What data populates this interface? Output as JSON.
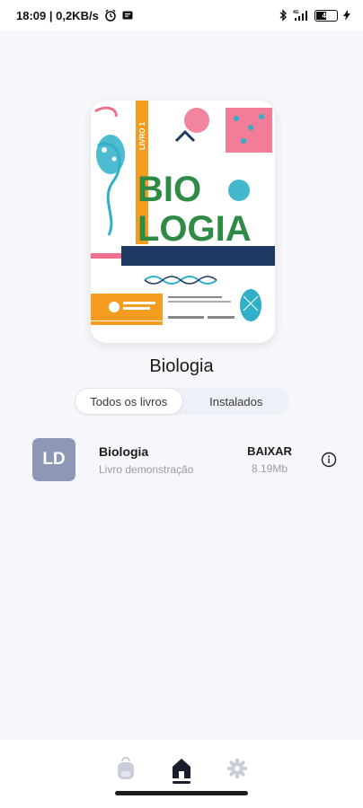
{
  "status_bar": {
    "time_speed": "18:09 | 0,2KB/s",
    "signal_label": "4G",
    "battery": "44"
  },
  "cover": {
    "series": "LIVRO 1",
    "title_line1": "BIO",
    "title_line2": "LOGIA"
  },
  "book": {
    "title": "Biologia"
  },
  "tabs": [
    {
      "label": "Todos os livros",
      "active": true
    },
    {
      "label": "Instalados",
      "active": false
    }
  ],
  "list": [
    {
      "avatar": "LD",
      "title": "Biologia",
      "subtitle": "Livro demonstração",
      "action": "BAIXAR",
      "size": "8.19Mb"
    }
  ],
  "nav": {
    "items": [
      "backpack-icon",
      "home-icon",
      "gear-icon"
    ],
    "active": "home-icon"
  },
  "colors": {
    "accent": "#1a1d2e",
    "avatar_bg": "#8c98b5",
    "cover_orange": "#f39c1f",
    "cover_green": "#2f8a45",
    "cover_navy": "#1f3a62",
    "cover_teal": "#2fb0c8",
    "cover_pink": "#ef6f8e"
  }
}
